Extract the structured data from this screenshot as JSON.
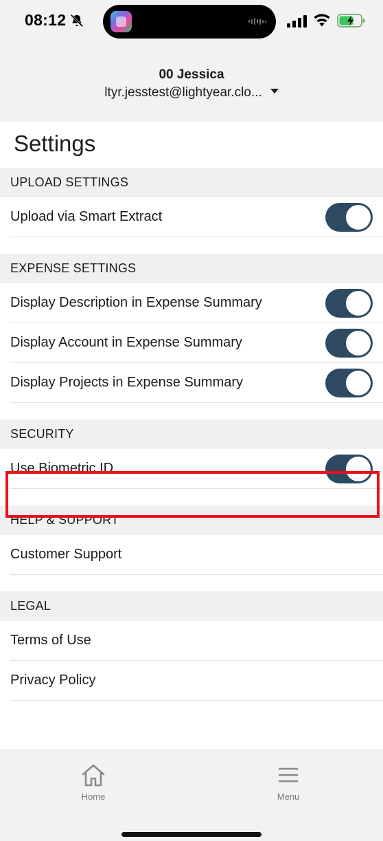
{
  "status_bar": {
    "time": "08:12"
  },
  "account": {
    "name": "00 Jessica",
    "email": "ltyr.jesstest@lightyear.clo..."
  },
  "page": {
    "title": "Settings"
  },
  "sections": {
    "upload": {
      "header": "UPLOAD SETTINGS",
      "items": [
        {
          "label": "Upload via Smart Extract",
          "toggle": true
        }
      ]
    },
    "expense": {
      "header": "EXPENSE SETTINGS",
      "items": [
        {
          "label": "Display Description in Expense Summary",
          "toggle": true
        },
        {
          "label": "Display Account in Expense Summary",
          "toggle": true
        },
        {
          "label": "Display Projects in Expense Summary",
          "toggle": true
        }
      ]
    },
    "security": {
      "header": "SECURITY",
      "items": [
        {
          "label": "Use Biometric ID",
          "toggle": true
        }
      ]
    },
    "help": {
      "header": "HELP & SUPPORT",
      "items": [
        {
          "label": "Customer Support"
        }
      ]
    },
    "legal": {
      "header": "LEGAL",
      "items": [
        {
          "label": "Terms of Use"
        },
        {
          "label": "Privacy Policy"
        }
      ]
    }
  },
  "tab_bar": {
    "home_label": "Home",
    "menu_label": "Menu"
  },
  "colors": {
    "toggle_on": "#2e4a63",
    "highlight_border": "#e8121c",
    "section_header_bg": "#f0f0f2"
  },
  "icons": {
    "silent": "bell-off-icon",
    "signal": "cellular-signal-icon",
    "wifi": "wifi-icon",
    "battery": "battery-charging-icon",
    "home": "home-icon",
    "menu": "hamburger-menu-icon"
  }
}
